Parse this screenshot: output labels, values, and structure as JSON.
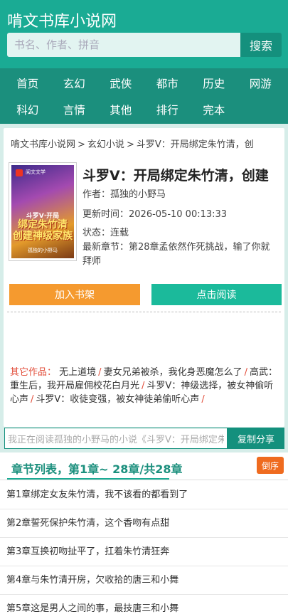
{
  "header": {
    "site_title": "啃文书库小说网",
    "search_placeholder": "书名、作者、拼音",
    "search_button": "搜索"
  },
  "nav": [
    "首页",
    "玄幻",
    "武侠",
    "都市",
    "历史",
    "网游",
    "科幻",
    "言情",
    "其他",
    "排行",
    "完本"
  ],
  "breadcrumb": {
    "home": "啃文书库小说网",
    "category": "玄幻小说",
    "current": "斗罗V：开局绑定朱竹清，创",
    "separator": ">"
  },
  "cover": {
    "publisher": "阅文文学",
    "title_line1": "斗罗V·开局",
    "title_line2": "绑定朱竹清 创建神级家族",
    "author_line": "孤独的小野马"
  },
  "book": {
    "title": "斗罗V：开局绑定朱竹清，创建",
    "author": "作者：孤独的小野马",
    "updated": "更新时间：2026-05-10 00:13:33",
    "status": "状态：连载",
    "latest": "最新章节：第28章孟依然作死挑战，输了你就拜师"
  },
  "actions": {
    "add_shelf": "加入书架",
    "read": "点击阅读"
  },
  "others": {
    "label": "其它作品：",
    "works": [
      "无上道境",
      "妻女兄弟被杀，我化身恶魔怎么了",
      "高武：重生后，我开局雇佣校花白月光",
      "斗罗V：神级选择，被女神偷听心声",
      "斗罗V：收徒变强，被女神徒弟偷听心声"
    ],
    "separator": "/"
  },
  "share": {
    "text": "我正在阅读孤独的小野马的小说《斗罗V：开局绑定朱竹",
    "button": "复制分享"
  },
  "chapters": {
    "heading": "章节列表，第1章~ 28章/共28章",
    "sort_button": "倒序",
    "items": [
      "第1章绑定女友朱竹清，我不该看的都看到了",
      "第2章誓死保护朱竹清，这个香吻有点甜",
      "第3章互换初吻扯平了，扛着朱竹清狂奔",
      "第4章与朱竹清开房，欠收拾的唐三和小舞",
      "第5章这是男人之间的事，最技唐三和小舞"
    ]
  }
}
